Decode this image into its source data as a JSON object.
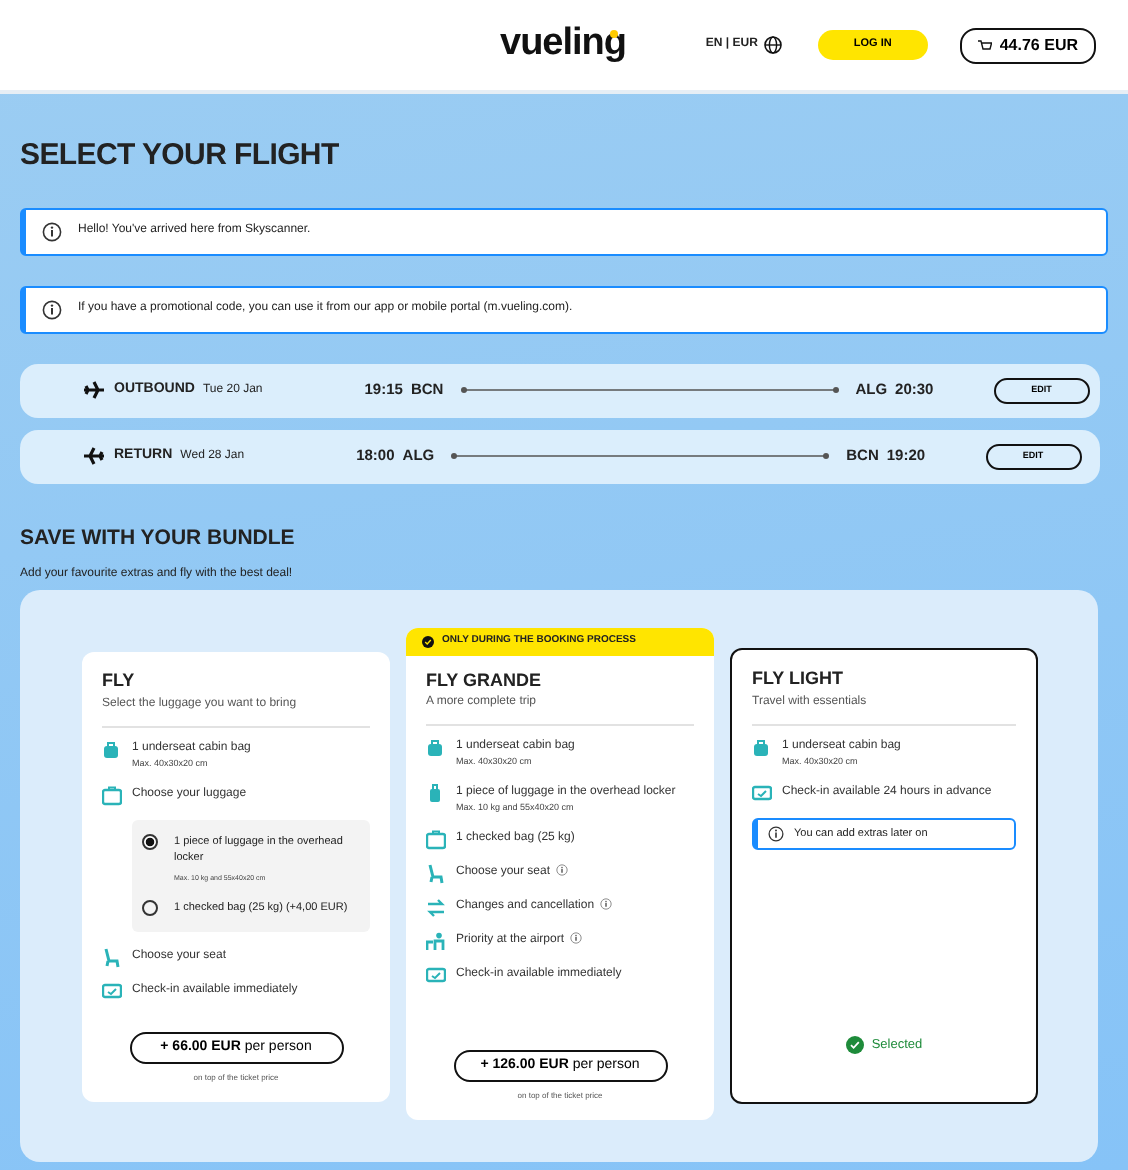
{
  "header": {
    "logo": "vueling",
    "locale": "EN | EUR",
    "login": "LOG IN",
    "cart": "44.76 EUR"
  },
  "title": "SELECT YOUR FLIGHT",
  "alerts": [
    "Hello! You've arrived here from Skyscanner.",
    "If you have a promotional code, you can use it from our app or mobile portal (m.vueling.com)."
  ],
  "flights": [
    {
      "kind": "outbound",
      "label": "OUTBOUND",
      "date": "Tue 20 Jan",
      "dep_time": "19:15",
      "dep_airport": "BCN",
      "arr_airport": "ALG",
      "arr_time": "20:30",
      "button": "EDIT"
    },
    {
      "kind": "return",
      "label": "RETURN",
      "date": "Wed 28 Jan",
      "dep_time": "18:00",
      "dep_airport": "ALG",
      "arr_airport": "BCN",
      "arr_time": "19:20",
      "button": "EDIT"
    }
  ],
  "bundle": {
    "title": "SAVE WITH YOUR BUNDLE",
    "subtitle": "Add your favourite extras and fly with the best deal!",
    "cards": [
      {
        "name": "FLY",
        "subtitle": "Select the luggage you want to bring",
        "selected": false,
        "features": [
          {
            "kind": "cabin-bag",
            "text": "1 underseat cabin bag",
            "note": "Max. 40x30x20 cm",
            "info": false
          },
          {
            "kind": "luggage",
            "text": "Choose your luggage",
            "info": false,
            "options": [
              {
                "text": "1 piece of luggage in the overhead locker",
                "note": "Max. 10 kg and 55x40x20 cm",
                "selected": true
              },
              {
                "text": "1 checked bag (25 kg) (+4,00 EUR)",
                "selected": false
              }
            ]
          },
          {
            "kind": "seat",
            "text": "Choose your seat",
            "info": false
          },
          {
            "kind": "checkin",
            "text": "Check-in available immediately",
            "info": false
          }
        ],
        "price": {
          "amount": "+ 66.00 EUR",
          "unit": "per person",
          "note": "on top of the ticket price"
        }
      },
      {
        "name": "FLY GRANDE",
        "ribbon": "ONLY DURING THE BOOKING PROCESS",
        "subtitle": "A more complete trip",
        "selected": false,
        "features": [
          {
            "kind": "cabin-bag",
            "text": "1 underseat cabin bag",
            "note": "Max. 40x30x20 cm",
            "info": false
          },
          {
            "kind": "trolley",
            "text": "1 piece of luggage in the overhead locker",
            "note": "Max. 10 kg and 55x40x20 cm",
            "info": false
          },
          {
            "kind": "luggage",
            "text": "1 checked bag (25 kg)",
            "info": false
          },
          {
            "kind": "seat",
            "text": "Choose your seat",
            "info": true
          },
          {
            "kind": "changes",
            "text": "Changes and cancellation",
            "info": true
          },
          {
            "kind": "priority",
            "text": "Priority at the airport",
            "info": true
          },
          {
            "kind": "checkin",
            "text": "Check-in available immediately",
            "info": false
          }
        ],
        "price": {
          "amount": "+ 126.00 EUR",
          "unit": "per person",
          "note": "on top of the ticket price"
        }
      },
      {
        "name": "FLY LIGHT",
        "subtitle": "Travel with essentials",
        "selected": true,
        "features": [
          {
            "kind": "cabin-bag",
            "text": "1 underseat cabin bag",
            "note": "Max. 40x30x20 cm",
            "info": false
          },
          {
            "kind": "checkin",
            "text": "Check-in available 24 hours in advance",
            "info": false
          }
        ],
        "notice": "You can add extras later on",
        "status": "Selected"
      }
    ]
  }
}
